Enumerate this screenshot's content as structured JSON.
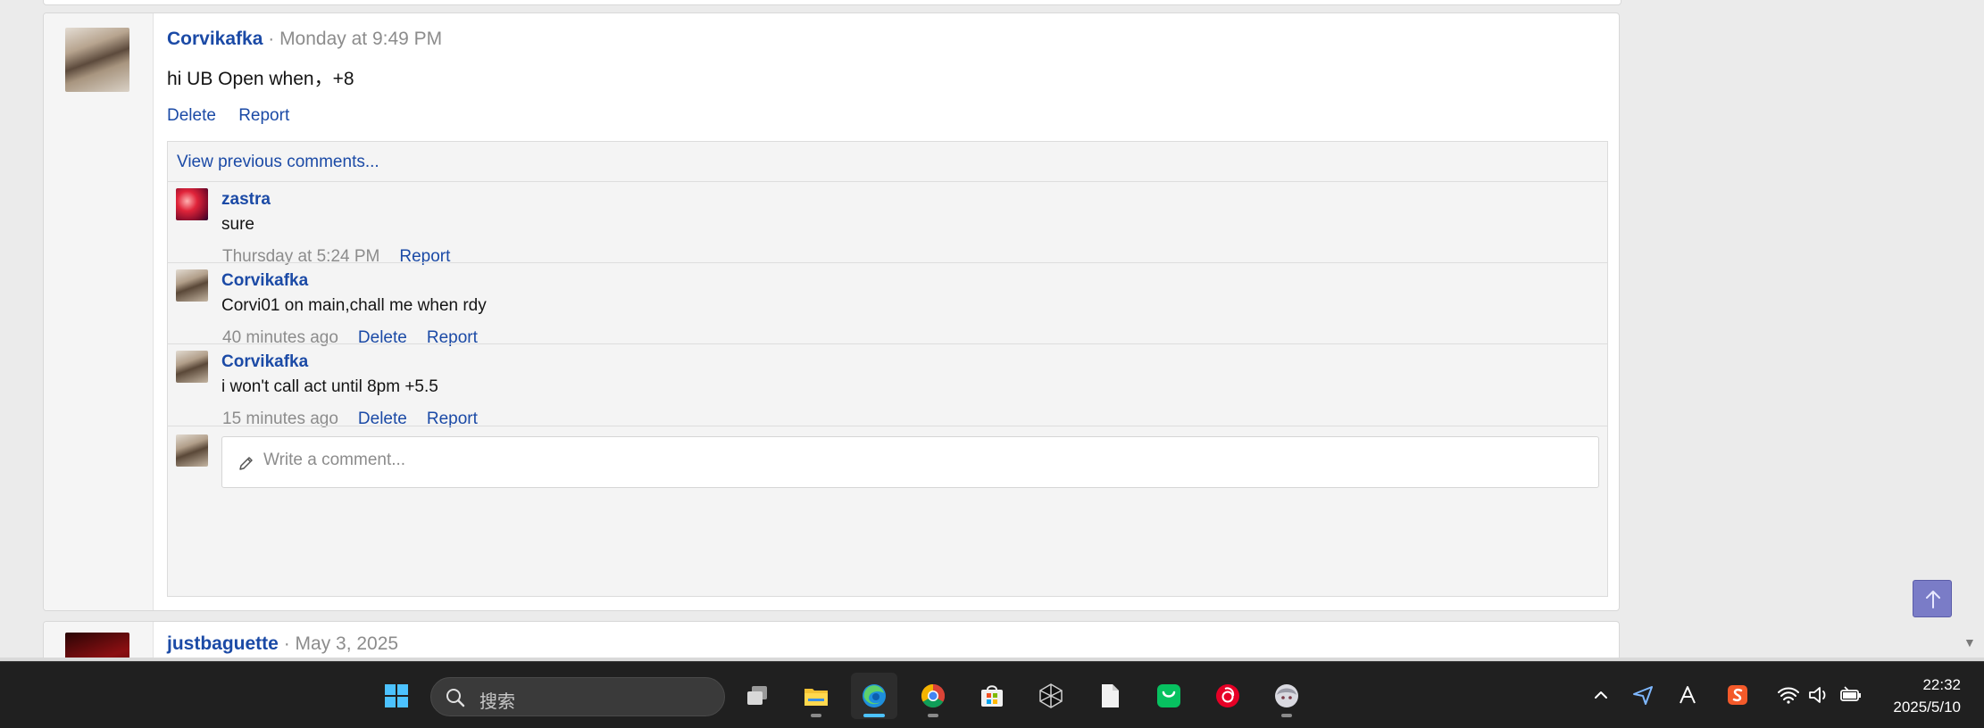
{
  "post": {
    "author": "Corvikafka",
    "time": "Monday at 9:49 PM",
    "body": "hi UB Open when，+8",
    "actions": {
      "delete": "Delete",
      "report": "Report"
    }
  },
  "comments": {
    "view_previous": "View previous comments...",
    "items": [
      {
        "author": "zastra",
        "text": "sure",
        "time": "Thursday at 5:24 PM",
        "report": "Report"
      },
      {
        "author": "Corvikafka",
        "text": "Corvi01 on main,chall me when rdy",
        "time": "40 minutes ago",
        "delete": "Delete",
        "report": "Report"
      },
      {
        "author": "Corvikafka",
        "text": "i won't call act until 8pm +5.5",
        "time": "15 minutes ago",
        "delete": "Delete",
        "report": "Report"
      }
    ],
    "write_placeholder": "Write a comment..."
  },
  "next_post": {
    "author": "justbaguette",
    "time": "May 3, 2025"
  },
  "taskbar": {
    "search_placeholder": "搜索",
    "clock_time": "22:32",
    "clock_date": "2025/5/10",
    "apps": [
      "start-icon",
      "task-view-icon",
      "file-explorer-icon",
      "edge-icon",
      "chrome-icon",
      "microsoft-store-icon",
      "unity-icon",
      "file-icon",
      "wechat-icon",
      "netease-music-icon",
      "anime-avatar-icon"
    ],
    "tray": [
      "chevron-up-icon",
      "send-icon",
      "font-a-icon",
      "sogou-icon",
      "wifi-icon",
      "volume-icon",
      "battery-icon"
    ]
  },
  "colors": {
    "link": "#1b4aa6",
    "muted": "#8c8c8c",
    "scroll_top": "#7a7cc7",
    "taskbar": "#202020"
  }
}
